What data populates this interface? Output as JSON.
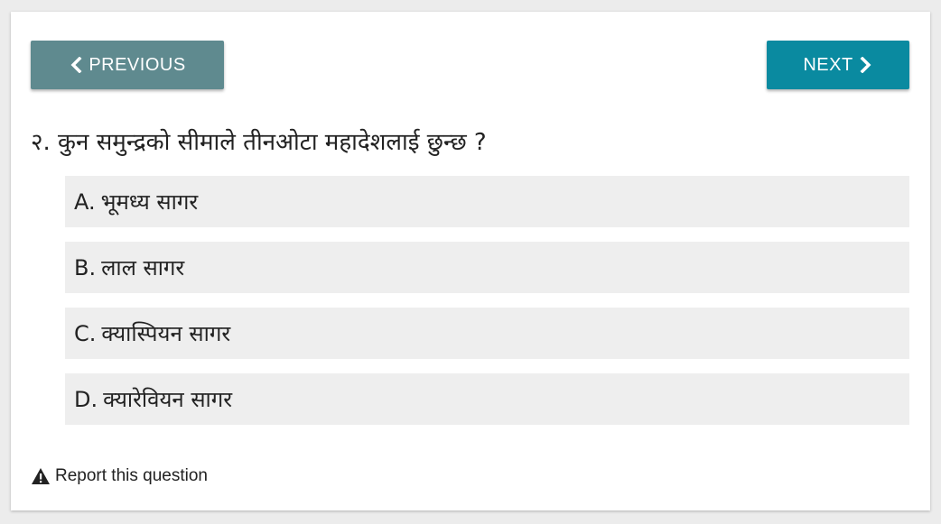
{
  "nav": {
    "previous_label": "PREVIOUS",
    "next_label": "NEXT",
    "previous_icon": "chevron-left-icon",
    "next_icon": "chevron-right-icon"
  },
  "question": {
    "text": "२. कुन समुन्द्रको सीमाले तीनओटा महादेशलाई छुन्छ ?"
  },
  "options": [
    {
      "letter": "A.",
      "text": "भूमध्य सागर"
    },
    {
      "letter": "B.",
      "text": "लाल सागर"
    },
    {
      "letter": "C.",
      "text": "क्यास्पियन सागर"
    },
    {
      "letter": "D.",
      "text": "क्यारेवियन सागर"
    }
  ],
  "report": {
    "label": "Report this question",
    "icon": "warning-icon"
  },
  "colors": {
    "previous_button": "#5f8a8f",
    "next_button": "#0a8aa0",
    "option_background": "#eeeeee",
    "page_background": "#ececec",
    "card_background": "#ffffff"
  }
}
